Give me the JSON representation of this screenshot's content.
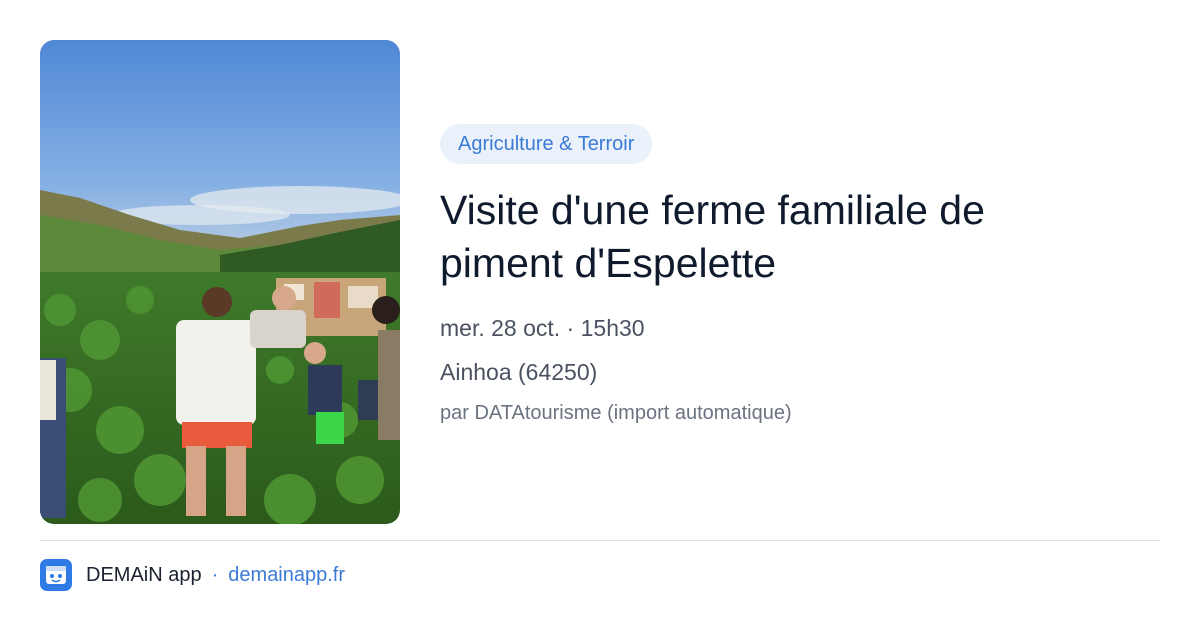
{
  "event": {
    "category": "Agriculture & Terroir",
    "title": "Visite d'une ferme familiale de piment d'Espelette",
    "datetime": "mer. 28 oct. · 15h30",
    "location": "Ainhoa (64250)",
    "source": "par DATAtourisme (import automatique)"
  },
  "footer": {
    "app_name": "DEMAiN app",
    "separator": "·",
    "link": "demainapp.fr",
    "logo_icon": "demain-app-logo-icon"
  },
  "colors": {
    "accent": "#3b7bd6",
    "badge_bg": "#eaf1fb",
    "title": "#0f1a2c",
    "meta": "#4a5261",
    "divider": "#dfe3e8"
  }
}
